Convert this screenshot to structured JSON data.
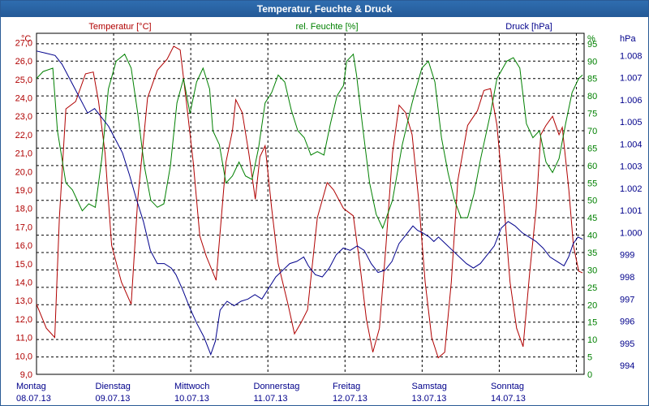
{
  "window": {
    "title": "Temperatur, Feuchte & Druck"
  },
  "colors": {
    "temperature": "#b00000",
    "humidity": "#008000",
    "pressure": "#00008b",
    "grid": "#000000",
    "title_bar": "#2a65a6"
  },
  "chart_data": {
    "type": "line",
    "title": "Temperatur, Feuchte & Druck",
    "grid": true,
    "x_categories": [
      {
        "day": "Montag",
        "date": "08.07.13"
      },
      {
        "day": "Dienstag",
        "date": "09.07.13"
      },
      {
        "day": "Mittwoch",
        "date": "10.07.13"
      },
      {
        "day": "Donnerstag",
        "date": "11.07.13"
      },
      {
        "day": "Freitag",
        "date": "12.07.13"
      },
      {
        "day": "Samstag",
        "date": "13.07.13"
      },
      {
        "day": "Sonntag",
        "date": "14.07.13"
      }
    ],
    "days_range": [
      0,
      7.1
    ],
    "axes": {
      "temperature": {
        "label": "Temperatur [°C]",
        "unit": "°C",
        "min": 9.0,
        "max": 27.5,
        "ticks": [
          "9,0",
          "10,0",
          "11,0",
          "12,0",
          "13,0",
          "14,0",
          "15,0",
          "16,0",
          "17,0",
          "18,0",
          "19,0",
          "20,0",
          "21,0",
          "22,0",
          "23,0",
          "24,0",
          "25,0",
          "26,0",
          "27,0"
        ]
      },
      "humidity": {
        "label": "rel. Feuchte [%]",
        "unit": "%",
        "min": 0,
        "max": 98,
        "ticks": [
          "0",
          "5",
          "10",
          "15",
          "20",
          "25",
          "30",
          "35",
          "40",
          "45",
          "50",
          "55",
          "60",
          "65",
          "70",
          "75",
          "80",
          "85",
          "90",
          "95"
        ]
      },
      "pressure": {
        "label": "Druck [hPa]",
        "unit": "hPa",
        "min": 993.6,
        "max": 1009.0,
        "ticks": [
          "994",
          "995",
          "996",
          "997",
          "998",
          "999",
          "1.000",
          "1.001",
          "1.002",
          "1.003",
          "1.004",
          "1.005",
          "1.006",
          "1.007",
          "1.008"
        ]
      }
    },
    "series": [
      {
        "name": "Temperatur [°C]",
        "axis": "temperature",
        "color": "#b00000",
        "points": [
          [
            0,
            12.8
          ],
          [
            0.15,
            11.5
          ],
          [
            0.28,
            11.0
          ],
          [
            0.35,
            17.5
          ],
          [
            0.45,
            23.4
          ],
          [
            0.6,
            23.8
          ],
          [
            0.75,
            25.3
          ],
          [
            0.87,
            25.4
          ],
          [
            0.95,
            23.8
          ],
          [
            1.05,
            21.0
          ],
          [
            1.15,
            16.0
          ],
          [
            1.3,
            14.0
          ],
          [
            1.45,
            12.8
          ],
          [
            1.55,
            18.5
          ],
          [
            1.7,
            24.0
          ],
          [
            1.85,
            25.5
          ],
          [
            2.0,
            26.1
          ],
          [
            2.1,
            26.8
          ],
          [
            2.2,
            26.6
          ],
          [
            2.3,
            23.6
          ],
          [
            2.4,
            20.5
          ],
          [
            2.5,
            16.5
          ],
          [
            2.6,
            15.4
          ],
          [
            2.75,
            14.1
          ],
          [
            2.9,
            20.5
          ],
          [
            3.0,
            22.2
          ],
          [
            3.05,
            23.9
          ],
          [
            3.15,
            23.2
          ],
          [
            3.25,
            21.0
          ],
          [
            3.35,
            18.5
          ],
          [
            3.42,
            20.8
          ],
          [
            3.5,
            21.4
          ],
          [
            3.6,
            18.0
          ],
          [
            3.7,
            15.0
          ],
          [
            3.85,
            12.8
          ],
          [
            3.95,
            11.2
          ],
          [
            4.05,
            11.8
          ],
          [
            4.15,
            12.5
          ],
          [
            4.3,
            17.5
          ],
          [
            4.45,
            19.4
          ],
          [
            4.55,
            19.0
          ],
          [
            4.7,
            18.0
          ],
          [
            4.85,
            17.6
          ],
          [
            4.95,
            15.0
          ],
          [
            5.05,
            12.0
          ],
          [
            5.15,
            10.2
          ],
          [
            5.25,
            11.5
          ],
          [
            5.35,
            16.0
          ],
          [
            5.45,
            21.0
          ],
          [
            5.55,
            23.6
          ],
          [
            5.65,
            23.2
          ],
          [
            5.75,
            22.0
          ],
          [
            5.85,
            18.5
          ],
          [
            5.95,
            14.0
          ],
          [
            6.05,
            11.0
          ],
          [
            6.15,
            9.9
          ],
          [
            6.25,
            10.2
          ],
          [
            6.35,
            14.0
          ],
          [
            6.45,
            19.5
          ],
          [
            6.6,
            22.5
          ],
          [
            6.75,
            23.3
          ],
          [
            6.85,
            24.4
          ],
          [
            6.95,
            24.5
          ],
          [
            7.05,
            22.5
          ],
          [
            7.15,
            18.5
          ],
          [
            7.25,
            14.0
          ],
          [
            7.35,
            11.5
          ],
          [
            7.45,
            10.5
          ],
          [
            7.55,
            14.5
          ],
          [
            7.65,
            18.0
          ],
          [
            7.72,
            22.0
          ],
          [
            7.8,
            22.5
          ],
          [
            7.9,
            23.0
          ],
          [
            8.0,
            22.0
          ],
          [
            8.05,
            22.4
          ],
          [
            8.15,
            19.0
          ],
          [
            8.22,
            16.0
          ],
          [
            8.3,
            14.6
          ],
          [
            8.36,
            14.5
          ]
        ]
      },
      {
        "name": "rel. Feuchte [%]",
        "axis": "humidity",
        "color": "#008000",
        "points": [
          [
            0,
            85
          ],
          [
            0.1,
            87
          ],
          [
            0.25,
            88
          ],
          [
            0.32,
            70
          ],
          [
            0.45,
            55
          ],
          [
            0.55,
            53
          ],
          [
            0.7,
            47
          ],
          [
            0.8,
            49
          ],
          [
            0.9,
            48
          ],
          [
            1.0,
            62
          ],
          [
            1.1,
            82
          ],
          [
            1.22,
            90
          ],
          [
            1.35,
            92
          ],
          [
            1.45,
            88
          ],
          [
            1.55,
            75
          ],
          [
            1.65,
            60
          ],
          [
            1.75,
            50
          ],
          [
            1.85,
            48
          ],
          [
            1.95,
            49
          ],
          [
            2.05,
            60
          ],
          [
            2.15,
            78
          ],
          [
            2.25,
            85
          ],
          [
            2.35,
            75
          ],
          [
            2.45,
            84
          ],
          [
            2.55,
            88
          ],
          [
            2.65,
            82
          ],
          [
            2.7,
            70
          ],
          [
            2.8,
            66
          ],
          [
            2.9,
            55
          ],
          [
            3.0,
            57
          ],
          [
            3.1,
            61
          ],
          [
            3.2,
            57
          ],
          [
            3.3,
            56
          ],
          [
            3.4,
            65
          ],
          [
            3.5,
            78
          ],
          [
            3.6,
            81
          ],
          [
            3.7,
            86
          ],
          [
            3.8,
            84
          ],
          [
            3.9,
            76
          ],
          [
            4.0,
            70
          ],
          [
            4.1,
            68
          ],
          [
            4.2,
            63
          ],
          [
            4.3,
            64
          ],
          [
            4.4,
            63
          ],
          [
            4.5,
            72
          ],
          [
            4.6,
            80
          ],
          [
            4.7,
            83
          ],
          [
            4.75,
            90
          ],
          [
            4.85,
            92
          ],
          [
            4.9,
            86
          ],
          [
            5.0,
            70
          ],
          [
            5.1,
            55
          ],
          [
            5.2,
            46
          ],
          [
            5.3,
            42
          ],
          [
            5.45,
            50
          ],
          [
            5.6,
            66
          ],
          [
            5.75,
            78
          ],
          [
            5.9,
            88
          ],
          [
            6.0,
            90
          ],
          [
            6.1,
            84
          ],
          [
            6.2,
            68
          ],
          [
            6.3,
            58
          ],
          [
            6.4,
            50
          ],
          [
            6.5,
            45
          ],
          [
            6.6,
            45
          ],
          [
            6.7,
            52
          ],
          [
            6.8,
            62
          ],
          [
            6.95,
            75
          ],
          [
            7.05,
            85
          ],
          [
            7.2,
            90
          ],
          [
            7.3,
            91
          ],
          [
            7.4,
            88
          ],
          [
            7.5,
            72
          ],
          [
            7.6,
            68
          ],
          [
            7.7,
            70
          ],
          [
            7.8,
            61
          ],
          [
            7.9,
            58
          ],
          [
            8.0,
            62
          ],
          [
            8.1,
            72
          ],
          [
            8.2,
            81
          ],
          [
            8.3,
            85
          ],
          [
            8.36,
            86
          ]
        ]
      },
      {
        "name": "Druck [hPa]",
        "axis": "pressure",
        "color": "#00008b",
        "points": [
          [
            0,
            1008.2
          ],
          [
            0.2,
            1008.1
          ],
          [
            0.4,
            1008.0
          ],
          [
            0.55,
            1007.6
          ],
          [
            0.7,
            1007.0
          ],
          [
            0.85,
            1006.4
          ],
          [
            1.0,
            1005.8
          ],
          [
            1.1,
            1005.4
          ],
          [
            1.25,
            1005.6
          ],
          [
            1.4,
            1005.2
          ],
          [
            1.55,
            1004.8
          ],
          [
            1.7,
            1004.2
          ],
          [
            1.85,
            1003.6
          ],
          [
            2.0,
            1002.6
          ],
          [
            2.15,
            1001.5
          ],
          [
            2.3,
            1000.5
          ],
          [
            2.45,
            999.2
          ],
          [
            2.6,
            998.6
          ],
          [
            2.75,
            998.6
          ],
          [
            2.9,
            998.4
          ],
          [
            3.0,
            998.1
          ],
          [
            3.15,
            997.4
          ],
          [
            3.3,
            996.6
          ],
          [
            3.45,
            995.9
          ],
          [
            3.6,
            995.3
          ],
          [
            3.75,
            994.5
          ],
          [
            3.85,
            995.1
          ],
          [
            3.95,
            996.5
          ],
          [
            4.1,
            996.9
          ],
          [
            4.25,
            996.7
          ],
          [
            4.4,
            996.9
          ],
          [
            4.55,
            997.0
          ],
          [
            4.7,
            997.2
          ],
          [
            4.85,
            997.0
          ],
          [
            5.0,
            997.5
          ],
          [
            5.15,
            998.0
          ],
          [
            5.3,
            998.3
          ],
          [
            5.45,
            998.6
          ],
          [
            5.6,
            998.7
          ],
          [
            5.75,
            998.9
          ],
          [
            5.85,
            998.5
          ],
          [
            6.0,
            998.1
          ],
          [
            6.15,
            998.0
          ],
          [
            6.3,
            998.4
          ],
          [
            6.45,
            999.0
          ],
          [
            6.6,
            999.3
          ],
          [
            6.75,
            999.2
          ],
          [
            6.9,
            999.4
          ],
          [
            7.05,
            999.2
          ],
          [
            7.2,
            998.6
          ],
          [
            7.35,
            998.2
          ],
          [
            7.5,
            998.3
          ],
          [
            7.65,
            998.7
          ],
          [
            7.8,
            999.5
          ],
          [
            7.95,
            999.9
          ],
          [
            8.1,
            1000.3
          ],
          [
            8.2,
            1000.1
          ],
          [
            8.3,
            1000.0
          ],
          [
            8.45,
            999.8
          ],
          [
            8.55,
            999.6
          ],
          [
            8.65,
            999.8
          ],
          [
            8.8,
            999.5
          ],
          [
            8.95,
            999.2
          ],
          [
            9.1,
            998.9
          ],
          [
            9.25,
            998.6
          ],
          [
            9.4,
            998.4
          ],
          [
            9.55,
            998.6
          ],
          [
            9.7,
            999.0
          ],
          [
            9.85,
            999.4
          ],
          [
            10.0,
            1000.2
          ],
          [
            10.15,
            1000.5
          ],
          [
            10.3,
            1000.3
          ],
          [
            10.45,
            1000.0
          ],
          [
            10.6,
            999.8
          ],
          [
            10.75,
            999.6
          ],
          [
            10.9,
            999.3
          ],
          [
            11.05,
            998.9
          ],
          [
            11.2,
            998.7
          ],
          [
            11.35,
            998.5
          ],
          [
            11.45,
            998.9
          ],
          [
            11.55,
            999.5
          ],
          [
            11.65,
            999.8
          ],
          [
            11.75,
            999.7
          ]
        ]
      }
    ]
  }
}
